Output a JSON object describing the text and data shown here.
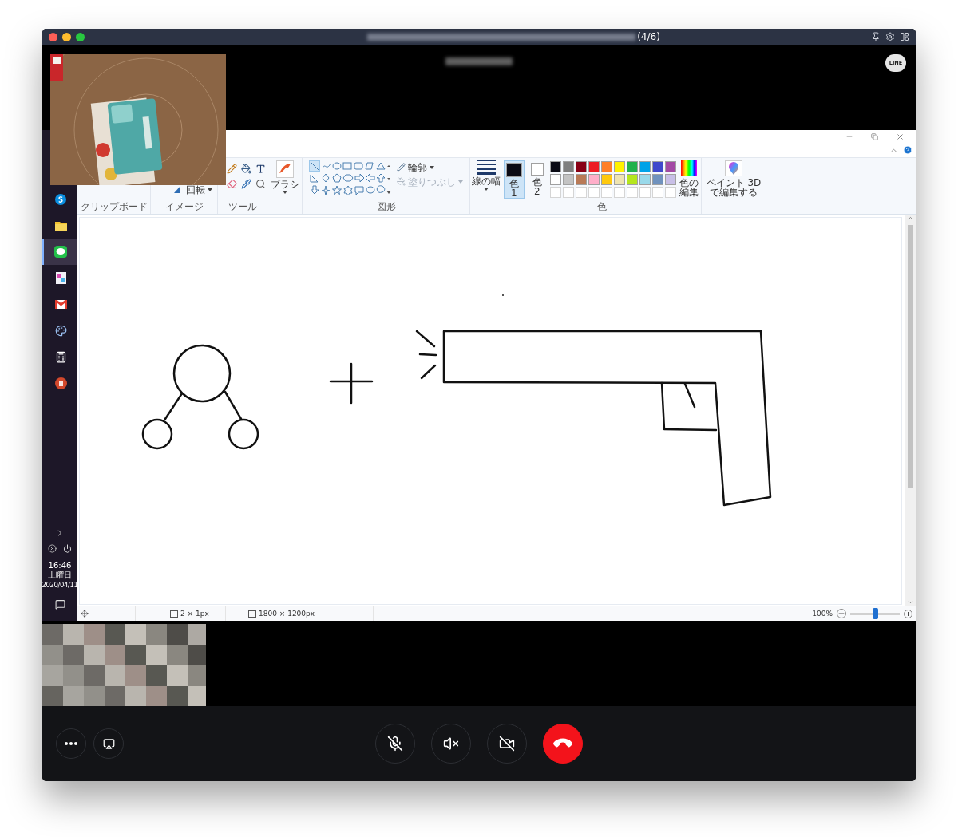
{
  "title_bar": {
    "counter": "(4/6)"
  },
  "line_logo": "LINE",
  "taskbar": {
    "apps": [
      {
        "kind": "skype",
        "selected": false
      },
      {
        "kind": "folder",
        "selected": false
      },
      {
        "kind": "chat",
        "selected": true
      },
      {
        "kind": "gallery",
        "selected": false
      },
      {
        "kind": "mail",
        "selected": false
      },
      {
        "kind": "palette",
        "selected": false
      },
      {
        "kind": "calculator",
        "selected": false
      },
      {
        "kind": "slides",
        "selected": false
      }
    ],
    "clock": {
      "time": "16:46",
      "day": "土曜日",
      "date": "2020/04/11"
    }
  },
  "paint": {
    "ribbon": {
      "clipboard": {
        "label": "クリップボード"
      },
      "image": {
        "label": "イメージ",
        "rotate": "回転"
      },
      "tools": {
        "label": "ツール"
      },
      "brush": {
        "label": "ブラシ"
      },
      "shapes": {
        "label": "図形",
        "outline": {
          "label": "輪郭",
          "disabled": false
        },
        "fill": {
          "label": "塗りつぶし",
          "disabled": true
        }
      },
      "line_width": {
        "label": "線の幅"
      },
      "colors": {
        "label": "色",
        "slots": [
          {
            "label": "色\n1",
            "color": "#0a0a14",
            "selected": true
          },
          {
            "label": "色\n2",
            "color": "#ffffff",
            "selected": false
          }
        ],
        "palette": [
          {
            "color": "#0a0a14"
          },
          {
            "color": "#7f7f7f"
          },
          {
            "color": "#880015"
          },
          {
            "color": "#ed1c24"
          },
          {
            "color": "#ff7f27"
          },
          {
            "color": "#fff200"
          },
          {
            "color": "#22b14c"
          },
          {
            "color": "#00a2e8"
          },
          {
            "color": "#3f48cc"
          },
          {
            "color": "#a349a4"
          },
          {
            "color": "#ffffff"
          },
          {
            "color": "#c3c3c3"
          },
          {
            "color": "#b97a57"
          },
          {
            "color": "#ffaec9"
          },
          {
            "color": "#ffc90e"
          },
          {
            "color": "#efe4b0"
          },
          {
            "color": "#b5e61d"
          },
          {
            "color": "#99d9ea"
          },
          {
            "color": "#7092be"
          },
          {
            "color": "#c8bfe7"
          }
        ],
        "edit": "色の編集"
      },
      "paint3d": "ペイント 3D\nで編集する"
    },
    "status_bar": {
      "selection": "2 × 1px",
      "image_size": "1800 × 1200px",
      "zoom": "100%",
      "zoom_slider": {
        "level": 0.5
      }
    }
  },
  "call_controls": {
    "left": [
      {
        "kind": "more"
      },
      {
        "kind": "screen"
      }
    ],
    "center": [
      {
        "kind": "mic",
        "on": false
      },
      {
        "kind": "speaker",
        "on": false
      },
      {
        "kind": "camera",
        "on": false
      },
      {
        "kind": "hangup"
      }
    ]
  }
}
